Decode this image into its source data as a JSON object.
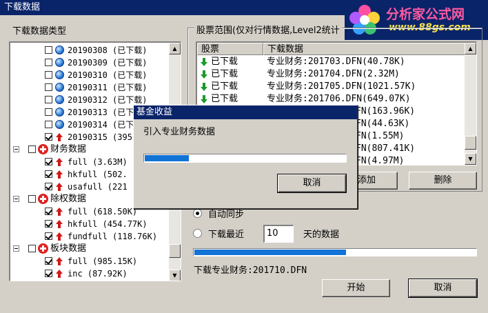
{
  "window": {
    "title": "下载数据"
  },
  "logo": {
    "name": "分析家公式网",
    "url": "www.88gs.com"
  },
  "left": {
    "label": "下载数据类型",
    "tree": [
      {
        "label": "20190308 (已下载)",
        "checked": false,
        "icon": "globe-icon"
      },
      {
        "label": "20190309 (已下载)",
        "checked": false,
        "icon": "globe-icon"
      },
      {
        "label": "20190310 (已下载)",
        "checked": false,
        "icon": "globe-icon"
      },
      {
        "label": "20190311 (已下载)",
        "checked": false,
        "icon": "globe-icon"
      },
      {
        "label": "20190312 (已下载)",
        "checked": false,
        "icon": "globe-icon"
      },
      {
        "label": "20190313 (已下载)",
        "checked": false,
        "icon": "globe-icon"
      },
      {
        "label": "20190314 (已下载)",
        "checked": false,
        "icon": "globe-icon"
      },
      {
        "label": "20190315 (395",
        "checked": true,
        "icon": "red-up-arrow-icon"
      },
      {
        "label": "财务数据",
        "checked": false,
        "icon": "red-plus-icon"
      },
      {
        "label": "full (3.63M)",
        "checked": true,
        "icon": "red-up-arrow-icon"
      },
      {
        "label": "hkfull (502.",
        "checked": true,
        "icon": "red-up-arrow-icon"
      },
      {
        "label": "usafull (221",
        "checked": true,
        "icon": "red-up-arrow-icon"
      },
      {
        "label": "除权数据",
        "checked": false,
        "icon": "red-plus-icon"
      },
      {
        "label": "full (618.50K)",
        "checked": true,
        "icon": "red-up-arrow-icon"
      },
      {
        "label": "hkfull (454.77K)",
        "checked": true,
        "icon": "red-up-arrow-icon"
      },
      {
        "label": "fundfull (118.76K)",
        "checked": true,
        "icon": "red-up-arrow-icon"
      },
      {
        "label": "板块数据",
        "checked": false,
        "icon": "red-plus-icon"
      },
      {
        "label": "full (985.15K)",
        "checked": true,
        "icon": "red-up-arrow-icon"
      },
      {
        "label": "inc (87.92K)",
        "checked": true,
        "icon": "red-up-arrow-icon"
      }
    ]
  },
  "right": {
    "group_label": "股票范围(仅对行情数据,Level2统计",
    "columns": [
      "股票",
      "下载数据"
    ],
    "rows": [
      {
        "status": "已下载",
        "file": "专业财务:201703.DFN(40.78K)"
      },
      {
        "status": "已下载",
        "file": "专业财务:201704.DFN(2.32M)"
      },
      {
        "status": "已下载",
        "file": "专业财务:201705.DFN(1021.57K)"
      },
      {
        "status": "已下载",
        "file": "专业财务:201706.DFN(649.07K)"
      },
      {
        "status": "",
        "file": "FN(163.96K)"
      },
      {
        "status": "",
        "file": "FN(44.63K)"
      },
      {
        "status": "",
        "file": "FN(1.55M)"
      },
      {
        "status": "",
        "file": "FN(807.41K)"
      },
      {
        "status": "",
        "file": "FN(4.97M)"
      }
    ],
    "add_button": "添加",
    "delete_button": "删除",
    "auto_sync_label": "自动同步",
    "recent_label": "下载最近",
    "recent_days": "10",
    "days_suffix": "天的数据",
    "progress_percent": 0.54,
    "status_text": "下载专业财务:201710.DFN",
    "start_button": "开始",
    "cancel_button": "取消"
  },
  "dialog": {
    "title": "基金收益",
    "message": "引入专业财务数据",
    "progress_percent": 0.22,
    "cancel_button": "取消"
  }
}
